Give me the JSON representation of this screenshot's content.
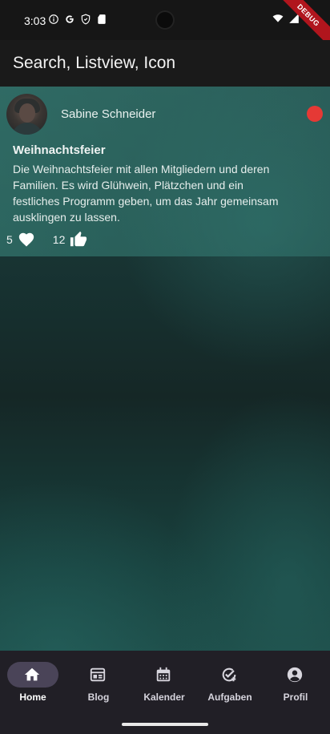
{
  "status_bar": {
    "time": "3:03",
    "icons": [
      "info-icon",
      "google-icon",
      "shield-icon",
      "sd-card-icon",
      "wifi-icon",
      "cellular-signal-icon",
      "battery-icon"
    ]
  },
  "debug_banner": "DEBUG",
  "app_bar": {
    "title": "Search, Listview, Icon"
  },
  "post": {
    "author": "Sabine Schneider",
    "status_color": "#e53935",
    "title": "Weihnachtsfeier",
    "body": "Die Weihnachtsfeier mit allen Mitgliedern und deren Familien. Es wird Glühwein, Plätzchen und ein festliches Programm geben, um das Jahr gemeinsam ausklingen zu lassen.",
    "likes": "5",
    "thumbs_up": "12"
  },
  "bottom_nav": {
    "items": [
      {
        "label": "Home",
        "icon": "home-icon",
        "active": true
      },
      {
        "label": "Blog",
        "icon": "blog-icon",
        "active": false
      },
      {
        "label": "Kalender",
        "icon": "calendar-icon",
        "active": false
      },
      {
        "label": "Aufgaben",
        "icon": "task-add-icon",
        "active": false
      },
      {
        "label": "Profil",
        "icon": "account-circle-icon",
        "active": false
      }
    ],
    "active_indicator_color": "#4a4458"
  }
}
